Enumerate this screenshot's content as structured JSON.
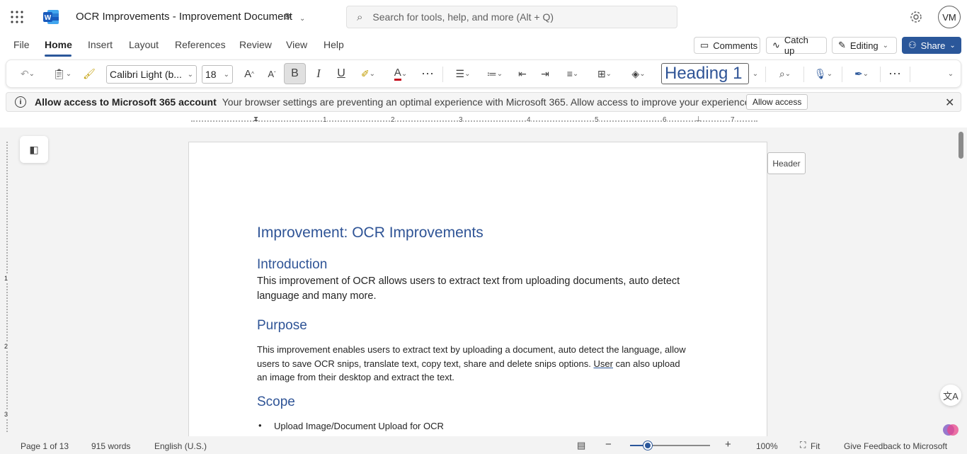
{
  "titlebar": {
    "doc_title": "OCR Improvements - Improvement Document",
    "search_placeholder": "Search for tools, help, and more (Alt + Q)",
    "avatar_initials": "VM"
  },
  "menu": {
    "items": [
      "File",
      "Home",
      "Insert",
      "Layout",
      "References",
      "Review",
      "View",
      "Help"
    ],
    "active": "Home"
  },
  "actions": {
    "comments": "Comments",
    "catchup": "Catch up",
    "editing": "Editing",
    "share": "Share"
  },
  "ribbon": {
    "font_name": "Calibri Light (b...",
    "font_size": "18",
    "style": "Heading 1",
    "bold_label": "B",
    "italic_label": "I",
    "underline_label": "U",
    "font_color_label": "A",
    "font_color": "#c50f1f"
  },
  "infobar": {
    "title": "Allow access to Microsoft 365 account",
    "message": "Your browser settings are preventing an optimal experience with Microsoft 365. Allow access to improve your experience.",
    "button": "Allow access"
  },
  "ruler": {
    "numbers": [
      "1",
      "2",
      "3",
      "4",
      "5",
      "6",
      "7"
    ]
  },
  "vruler": {
    "numbers": [
      "1",
      "2",
      "3"
    ]
  },
  "doc": {
    "title": "Improvement: OCR Improvements",
    "intro_heading": "Introduction",
    "intro_text": "This improvement of OCR allows users to extract text from uploading documents, auto detect language and many more.",
    "purpose_heading": "Purpose",
    "purpose_text_a": "This improvement enables users to extract text by uploading a document, auto detect the language, allow users to save OCR snips, translate text, copy text, share and delete snips options. ",
    "purpose_text_user": "User",
    "purpose_text_b": " can also upload an image from their desktop and extract the text.",
    "scope_heading": "Scope",
    "scope_items": [
      "Upload Image/Document Upload for OCR"
    ]
  },
  "header_tag": "Header",
  "status": {
    "page": "Page 1 of 13",
    "words": "915 words",
    "language": "English (U.S.)",
    "zoom": "100%",
    "fit": "Fit",
    "feedback": "Give Feedback to Microsoft"
  },
  "colors": {
    "accent": "#2b579a",
    "heading": "#2f5496",
    "word_brand": "#185abd"
  }
}
